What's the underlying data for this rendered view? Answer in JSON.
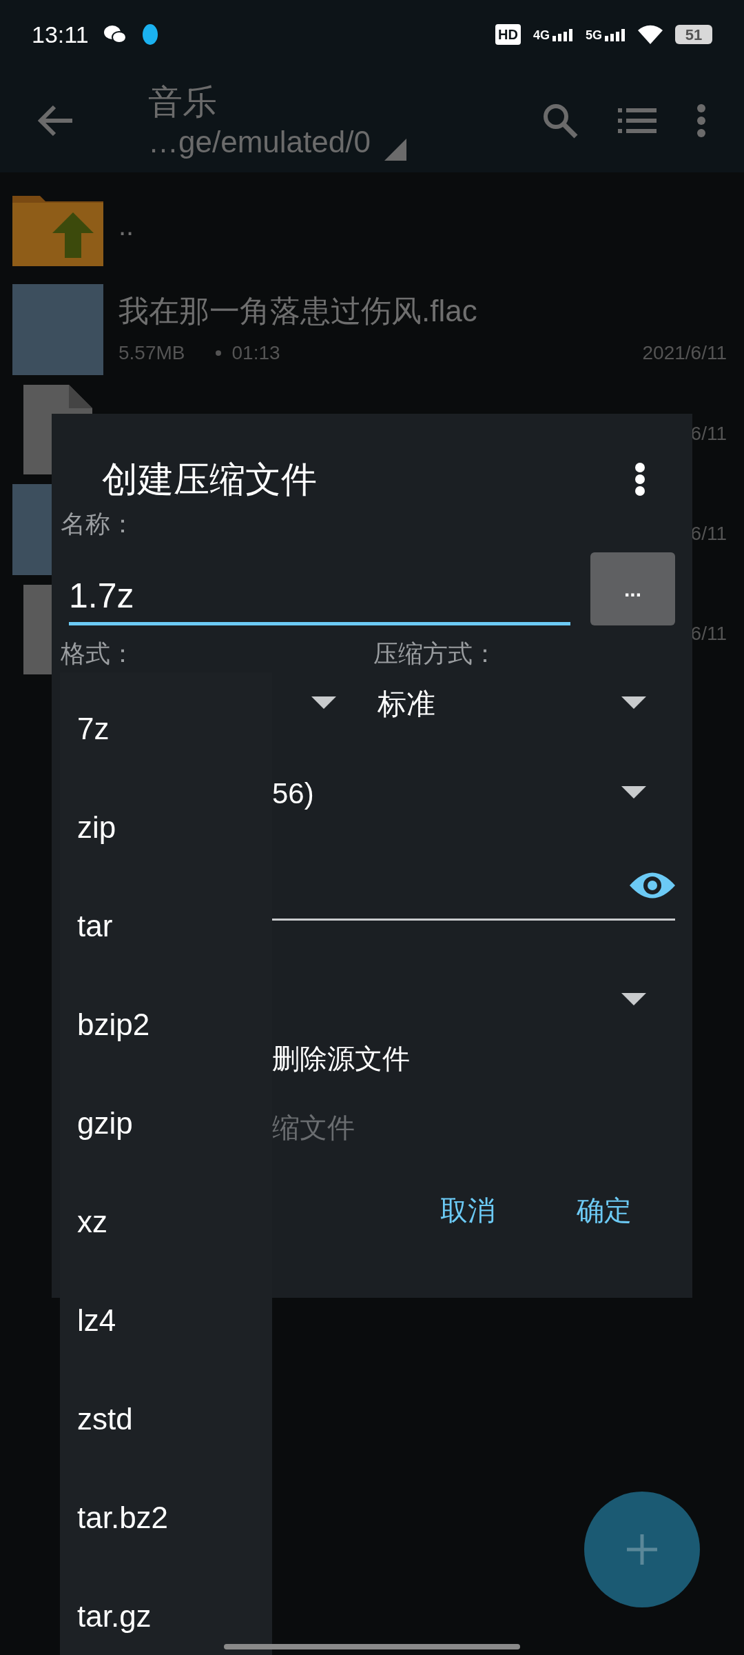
{
  "status_bar": {
    "time": "13:11",
    "hd": "HD",
    "net_1": "4G",
    "net_2": "5G",
    "battery": "51"
  },
  "app_bar": {
    "title": "音乐",
    "path": "…ge/emulated/0"
  },
  "files": [
    {
      "kind": "parent",
      "name": ".."
    },
    {
      "kind": "audio",
      "name": "我在那一角落患过伤风.flac",
      "size": "5.57MB",
      "duration": "01:13",
      "date": "2021/6/11"
    },
    {
      "kind": "file",
      "date": "6/11"
    },
    {
      "kind": "audio",
      "date": "6/11"
    },
    {
      "kind": "file",
      "date": "6/11"
    }
  ],
  "dialog": {
    "title": "创建压缩文件",
    "name_label": "名称：",
    "name_value": "1.7z",
    "browse_button": "...",
    "format_label": "格式：",
    "method_label": "压缩方式：",
    "method_value": "标准",
    "field_4": "56)",
    "field_7": {
      "label": "删除源文件",
      "disabled": false
    },
    "field_8": {
      "label": "缩文件",
      "disabled": true
    },
    "buttons": [
      "取消",
      "确定"
    ]
  },
  "format_menu": [
    "7z",
    "zip",
    "tar",
    "bzip2",
    "gzip",
    "xz",
    "lz4",
    "zstd",
    "tar.bz2",
    "tar.gz"
  ]
}
